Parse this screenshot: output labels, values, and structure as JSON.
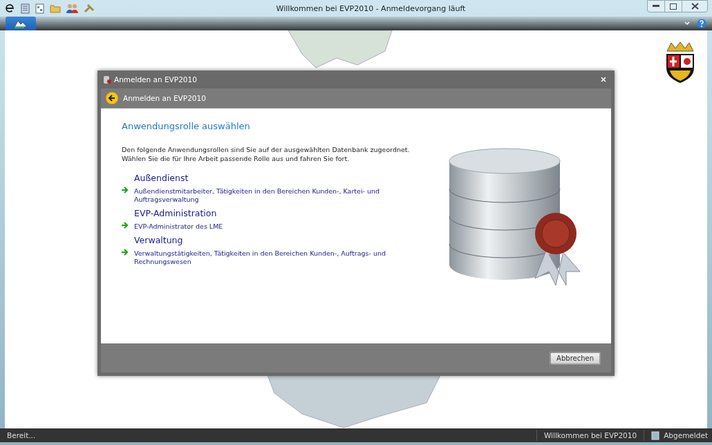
{
  "window": {
    "title": "Willkommen bei EVP2010 - Anmeldevorgang läuft"
  },
  "dialog": {
    "title": "Anmelden an EVP2010",
    "header": "Anmelden an EVP2010",
    "heading": "Anwendungsrolle auswählen",
    "intro": "Den folgende Anwendungsrollen sind Sie auf der ausgewählten Datenbank zugeordnet. Wählen Sie die für Ihre Arbeit passende Rolle aus und fahren Sie fort.",
    "roles": [
      {
        "name": "Außendienst",
        "description": "Außendienstmitarbeiter, Tätigkeiten in den Bereichen Kunden-, Kartei- und Auftragsverwaltung"
      },
      {
        "name": "EVP-Administration",
        "description": "EVP-Administrator des LME"
      },
      {
        "name": "Verwaltung",
        "description": "Verwaltungstätigkeiten, Tätigkeiten in den Bereichen Kunden-, Auftrags- und Rechnungswesen"
      }
    ],
    "buttons": [
      "Abbrechen"
    ]
  },
  "status_bar": {
    "left": "Bereit...",
    "welcome": "Willkommen bei EVP2010",
    "login_state": "Abgemeldet"
  }
}
